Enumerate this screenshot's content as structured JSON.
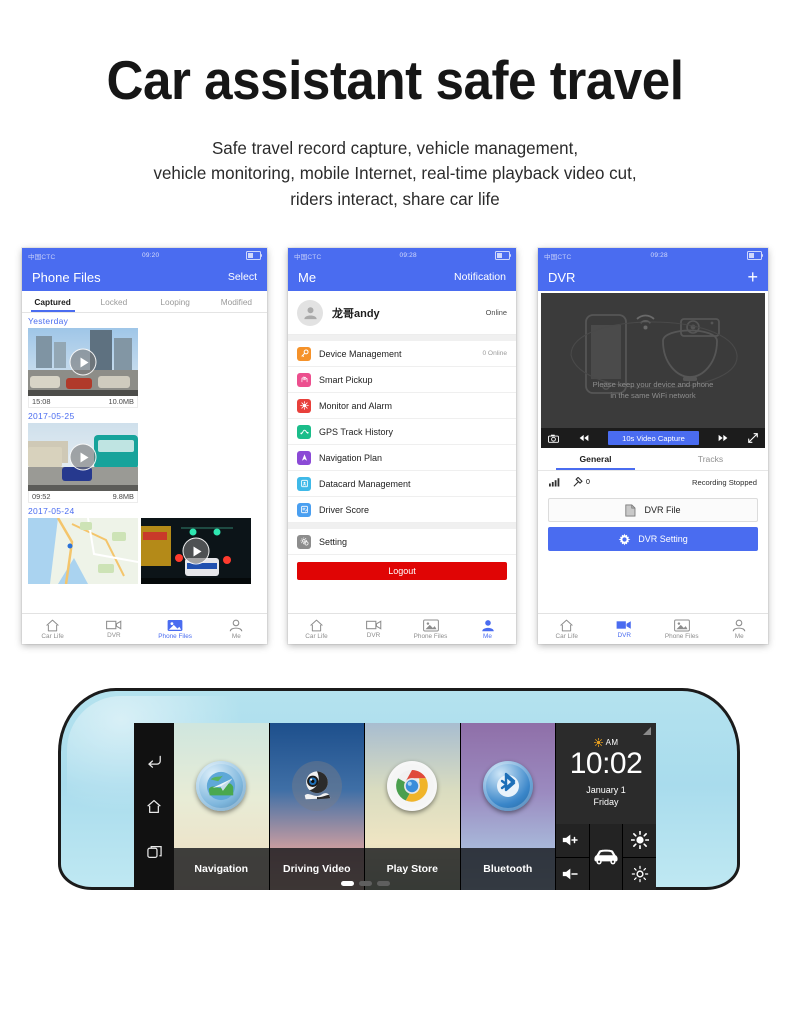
{
  "hero": {
    "title": "Car assistant safe travel",
    "subtitle_line1": "Safe travel record capture, vehicle management,",
    "subtitle_line2": "vehicle monitoring, mobile Internet, real-time playback video cut,",
    "subtitle_line3": "riders interact, share car life"
  },
  "colors": {
    "brand_blue": "#4a6cf0",
    "logout_red": "#e00505",
    "mirror_body": "#b4e2ee",
    "screen_black": "#000000",
    "widget_grey": "#2b2b2b"
  },
  "phone1": {
    "status": {
      "carrier": "中国CTC",
      "time": "09:20"
    },
    "nav": {
      "title": "Phone Files",
      "action": "Select"
    },
    "tabs": [
      {
        "label": "Captured",
        "active": true
      },
      {
        "label": "Locked",
        "active": false
      },
      {
        "label": "Looping",
        "active": false
      },
      {
        "label": "Modified",
        "active": false
      }
    ],
    "groups": [
      {
        "date": "Yesterday",
        "items": [
          {
            "time": "15:08",
            "size": "10.0MB",
            "kind": "video-day-city"
          }
        ]
      },
      {
        "date": "2017-05-25",
        "items": [
          {
            "time": "09:52",
            "size": "9.8MB",
            "kind": "video-day-bus"
          }
        ]
      },
      {
        "date": "2017-05-24",
        "items": [
          {
            "kind": "map"
          },
          {
            "kind": "video-night"
          }
        ]
      }
    ],
    "tabbar": [
      {
        "label": "Car Life",
        "icon": "home-icon",
        "active": false
      },
      {
        "label": "DVR",
        "icon": "camcorder-icon",
        "active": false
      },
      {
        "label": "Phone Files",
        "icon": "photos-icon",
        "active": true
      },
      {
        "label": "Me",
        "icon": "person-icon",
        "active": false
      }
    ]
  },
  "phone2": {
    "status": {
      "carrier": "中国CTC",
      "time": "09:28"
    },
    "nav": {
      "title": "Me",
      "action": "Notification"
    },
    "profile": {
      "name": "龙哥andy",
      "status": "Online",
      "avatar_icon": "person-icon"
    },
    "menu": [
      {
        "label": "Device Management",
        "value": "0 Online",
        "icon": "key-icon",
        "color": "#f5922a"
      },
      {
        "label": "Smart Pickup",
        "value": "",
        "icon": "hands-icon",
        "color": "#ec4f8e"
      },
      {
        "label": "Monitor and Alarm",
        "value": "",
        "icon": "alarm-icon",
        "color": "#e8403b"
      },
      {
        "label": "GPS Track History",
        "value": "",
        "icon": "track-icon",
        "color": "#1bbd8a"
      },
      {
        "label": "Navigation Plan",
        "value": "",
        "icon": "navigation-icon",
        "color": "#8b4ad6"
      },
      {
        "label": "Datacard Management",
        "value": "",
        "icon": "card-icon",
        "color": "#3fb9e8"
      },
      {
        "label": "Driver Score",
        "value": "",
        "icon": "score-icon",
        "color": "#4a9ff0"
      },
      {
        "label": "Setting",
        "value": "",
        "icon": "gear-icon",
        "color": "#8d8d8d"
      }
    ],
    "logout_label": "Logout",
    "tabbar": [
      {
        "label": "Car Life",
        "icon": "home-icon",
        "active": false
      },
      {
        "label": "DVR",
        "icon": "camcorder-icon",
        "active": false
      },
      {
        "label": "Phone Files",
        "icon": "photos-icon",
        "active": false
      },
      {
        "label": "Me",
        "icon": "person-icon",
        "active": true
      }
    ]
  },
  "phone3": {
    "status": {
      "carrier": "中国CTC",
      "time": "09:28"
    },
    "nav": {
      "title": "DVR",
      "action": "+"
    },
    "preview": {
      "hint_line1": "Please keep your device and phone",
      "hint_line2": "in the same WiFi network",
      "controls": {
        "snapshot": "camera-icon",
        "rewind": "rewind-icon",
        "capture_label": "10s Video Capture",
        "forward": "fast-forward-icon",
        "fullscreen": "fullscreen-icon"
      }
    },
    "segments": [
      {
        "label": "General",
        "active": true
      },
      {
        "label": "Tracks",
        "active": false
      }
    ],
    "stats": {
      "signal_icon": "signal-bars-icon",
      "satellite_icon": "satellite-icon",
      "satellite_count": "0",
      "status": "Recording Stopped"
    },
    "buttons": [
      {
        "label": "DVR File",
        "icon": "file-icon",
        "primary": false
      },
      {
        "label": "DVR Setting",
        "icon": "gear-icon",
        "primary": true
      }
    ],
    "tabbar": [
      {
        "label": "Car Life",
        "icon": "home-icon",
        "active": false
      },
      {
        "label": "DVR",
        "icon": "camcorder-icon",
        "active": true
      },
      {
        "label": "Phone Files",
        "icon": "photos-icon",
        "active": false
      },
      {
        "label": "Me",
        "icon": "person-icon",
        "active": false
      }
    ]
  },
  "mirror": {
    "nav_buttons": [
      {
        "icon": "back-icon"
      },
      {
        "icon": "home-icon"
      },
      {
        "icon": "recents-icon"
      }
    ],
    "apps": [
      {
        "label": "Navigation",
        "icon": "globe-navigation-icon"
      },
      {
        "label": "Driving Video",
        "icon": "webcam-icon"
      },
      {
        "label": "Play Store",
        "icon": "chrome-icon"
      },
      {
        "label": "Bluetooth",
        "icon": "bluetooth-icon"
      }
    ],
    "page_dots": {
      "count": 3,
      "active_index": 0
    },
    "widget": {
      "ampm": "AM",
      "sun_icon": "sun-icon",
      "time": "10:02",
      "date_line1": "January 1",
      "date_line2": "Friday",
      "signal_icon": "signal-triangle-icon"
    },
    "controls": [
      {
        "icon": "volume-up-icon"
      },
      {
        "icon": "car-icon"
      },
      {
        "icon": "brightness-high-icon"
      },
      {
        "icon": "volume-down-icon"
      },
      {
        "icon": "brightness-low-icon"
      }
    ]
  }
}
